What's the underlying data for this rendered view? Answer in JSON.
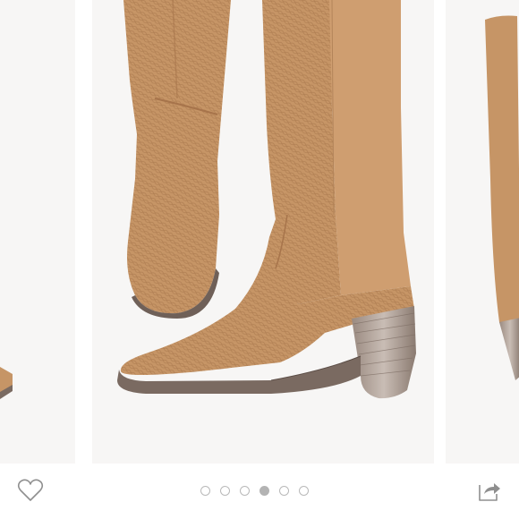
{
  "listing": {
    "active_photo": 4,
    "photo_count": 6
  },
  "icons": {
    "like": "heart-outline-icon",
    "share": "share-arrow-icon"
  },
  "colors": {
    "background": "#ffffff",
    "photo_bg": "#f7f6f5",
    "boot_tan": "#c69566",
    "boot_shadow": "#a7744b",
    "heel": "#7a6a61",
    "icon_gray": "#8f8f8f",
    "dot_inactive": "#b9b9b9",
    "dot_active": "#b3b3b3"
  }
}
